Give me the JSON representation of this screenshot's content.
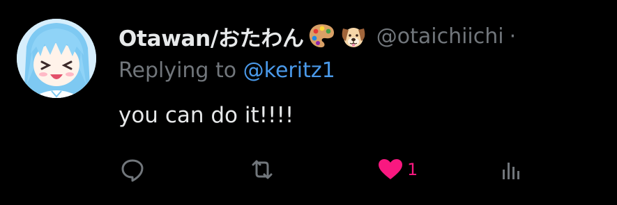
{
  "tweet": {
    "display_name": "Otawan/おたわん",
    "handle": "@otaichiichi",
    "separator": "·",
    "replying_prefix": "Replying to ",
    "replying_to": "@keritz1",
    "text": "you can do it!!!!"
  },
  "actions": {
    "reply_icon": "reply-icon",
    "retweet_icon": "retweet-icon",
    "like_icon": "heart-icon",
    "like_count": "1",
    "views_icon": "views-icon"
  },
  "colors": {
    "background": "#000000",
    "text": "#e7e9ea",
    "muted": "#71767b",
    "link": "#4a99e9",
    "like": "#f91880"
  }
}
